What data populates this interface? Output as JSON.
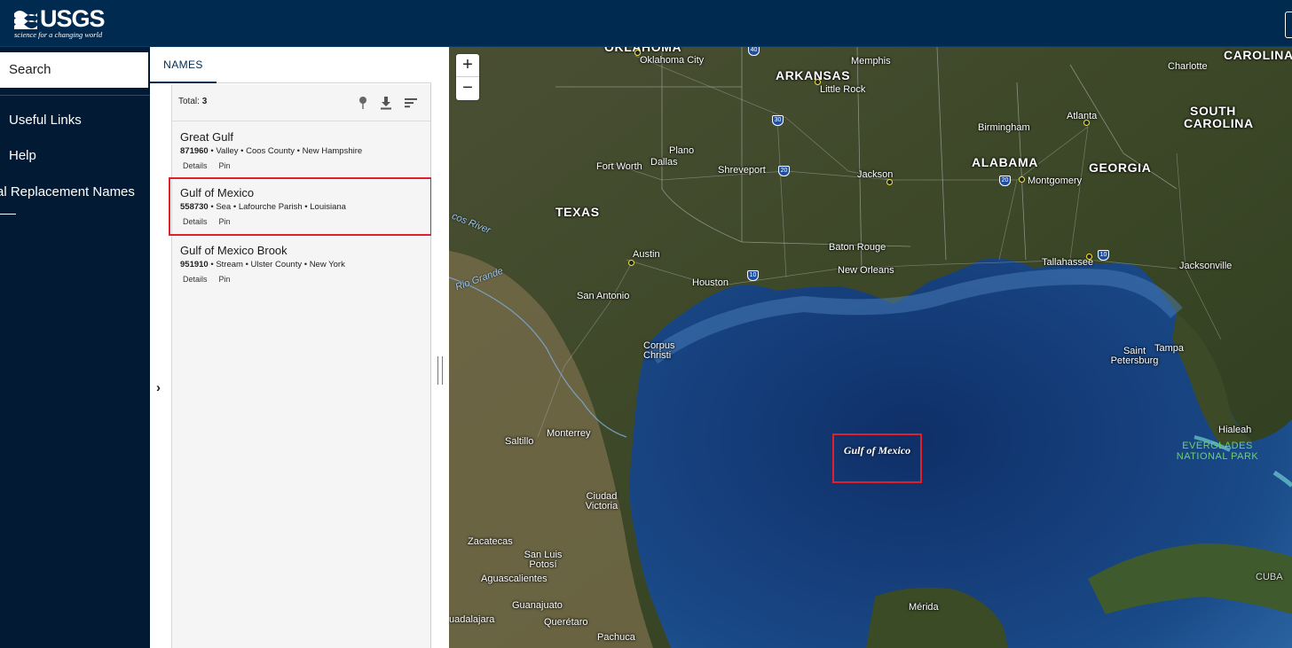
{
  "header": {
    "logo_text": "USGS",
    "logo_tagline": "science for a changing world"
  },
  "sidebar": {
    "search_label": "Search",
    "items": [
      {
        "label": "Useful Links"
      },
      {
        "label": "Help"
      },
      {
        "label": "al Replacement Names"
      }
    ]
  },
  "panel": {
    "tab_label": "NAMES",
    "total_label": "Total:",
    "total_count": "3",
    "icons": [
      "pin-icon",
      "download-icon",
      "sort-icon"
    ],
    "results": [
      {
        "name": "Great Gulf",
        "id": "871960",
        "meta": "Valley • Coos County • New Hampshire",
        "details": "Details",
        "pin": "Pin"
      },
      {
        "name": "Gulf of Mexico",
        "id": "558730",
        "meta": "Sea • Lafourche Parish • Louisiana",
        "details": "Details",
        "pin": "Pin"
      },
      {
        "name": "Gulf of Mexico Brook",
        "id": "951910",
        "meta": "Stream • Ulster County • New York",
        "details": "Details",
        "pin": "Pin"
      }
    ]
  },
  "map": {
    "zoom_in": "+",
    "zoom_out": "−",
    "gulf_label": "Gulf of Mexico",
    "states": [
      "OKLAHOMA",
      "ARKANSAS",
      "CAROLINA",
      "SOUTH CAROLINA",
      "TEXAS",
      "ALABAMA",
      "GEORGIA"
    ],
    "cities": [
      "Oklahoma City",
      "Memphis",
      "Little Rock",
      "Charlotte",
      "Atlanta",
      "Birmingham",
      "Plano",
      "Fort Worth",
      "Dallas",
      "Shreveport",
      "Jackson",
      "Montgomery",
      "Austin",
      "Baton Rouge",
      "New Orleans",
      "Tallahassee",
      "Jacksonville",
      "Houston",
      "San Antonio",
      "Corpus Christi",
      "Saint Petersburg",
      "Tampa",
      "Hialeah",
      "Monterrey",
      "Saltillo",
      "Ciudad Victoria",
      "Zacatecas",
      "San Luis Potosí",
      "Aguascalientes",
      "Guanajuato",
      "Querétaro",
      "uadalajara",
      "Pachuca",
      "Mérida",
      "CUBA"
    ],
    "rivers": [
      "Rio Grande",
      "cos River"
    ],
    "park": "EVERGLADES NATIONAL PARK",
    "interstates": [
      "40",
      "30",
      "20",
      "20",
      "10",
      "10"
    ]
  },
  "colors": {
    "header_bg": "#002a4f",
    "sidebar_bg": "#021a33",
    "highlight": "#e0202a"
  }
}
